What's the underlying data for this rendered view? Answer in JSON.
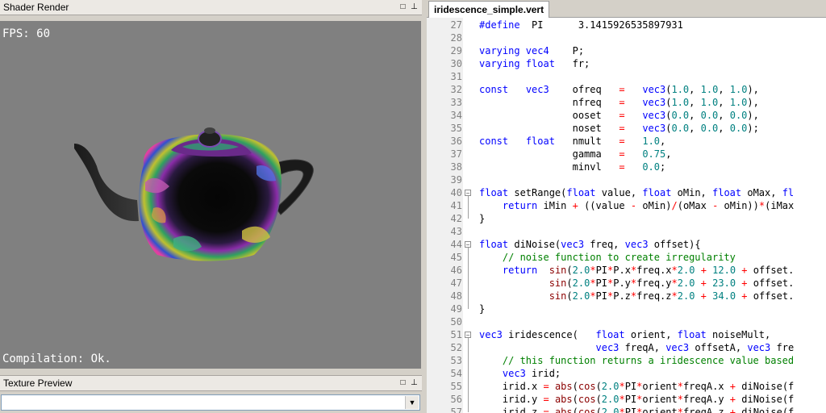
{
  "shader_render": {
    "title": "Shader Render",
    "fps_text": "FPS: 60",
    "status_text": "Compilation: Ok."
  },
  "texture_preview": {
    "title": "Texture Preview",
    "selected_value": ""
  },
  "editor": {
    "tab_label": "iridescence_simple.vert",
    "line_numbers": [
      "27",
      "28",
      "29",
      "30",
      "31",
      "32",
      "33",
      "34",
      "35",
      "36",
      "37",
      "38",
      "39",
      "40",
      "41",
      "42",
      "43",
      "44",
      "45",
      "46",
      "47",
      "48",
      "49",
      "50",
      "51",
      "52",
      "53",
      "54",
      "55",
      "56",
      "57"
    ],
    "lines": [
      [
        [
          "kw",
          "#define"
        ],
        [
          "",
          "  PI      3.1415926535897931"
        ]
      ],
      [],
      [
        [
          "kw",
          "varying vec4"
        ],
        [
          "",
          "    P;"
        ]
      ],
      [
        [
          "kw",
          "varying float"
        ],
        [
          "",
          "   fr;"
        ]
      ],
      [],
      [
        [
          "kw",
          "const"
        ],
        [
          "",
          "   "
        ],
        [
          "kw",
          "vec3"
        ],
        [
          "",
          "    ofreq   "
        ],
        [
          "op",
          "="
        ],
        [
          "",
          "   "
        ],
        [
          "kw",
          "vec3"
        ],
        [
          "",
          "("
        ],
        [
          "num",
          "1.0"
        ],
        [
          "",
          ", "
        ],
        [
          "num",
          "1.0"
        ],
        [
          "",
          ", "
        ],
        [
          "num",
          "1.0"
        ],
        [
          "",
          "),"
        ]
      ],
      [
        [
          "",
          "                nfreq   "
        ],
        [
          "op",
          "="
        ],
        [
          "",
          "   "
        ],
        [
          "kw",
          "vec3"
        ],
        [
          "",
          "("
        ],
        [
          "num",
          "1.0"
        ],
        [
          "",
          ", "
        ],
        [
          "num",
          "1.0"
        ],
        [
          "",
          ", "
        ],
        [
          "num",
          "1.0"
        ],
        [
          "",
          "),"
        ]
      ],
      [
        [
          "",
          "                ooset   "
        ],
        [
          "op",
          "="
        ],
        [
          "",
          "   "
        ],
        [
          "kw",
          "vec3"
        ],
        [
          "",
          "("
        ],
        [
          "num",
          "0.0"
        ],
        [
          "",
          ", "
        ],
        [
          "num",
          "0.0"
        ],
        [
          "",
          ", "
        ],
        [
          "num",
          "0.0"
        ],
        [
          "",
          "),"
        ]
      ],
      [
        [
          "",
          "                noset   "
        ],
        [
          "op",
          "="
        ],
        [
          "",
          "   "
        ],
        [
          "kw",
          "vec3"
        ],
        [
          "",
          "("
        ],
        [
          "num",
          "0.0"
        ],
        [
          "",
          ", "
        ],
        [
          "num",
          "0.0"
        ],
        [
          "",
          ", "
        ],
        [
          "num",
          "0.0"
        ],
        [
          "",
          ");"
        ]
      ],
      [
        [
          "kw",
          "const"
        ],
        [
          "",
          "   "
        ],
        [
          "kw",
          "float"
        ],
        [
          "",
          "   nmult   "
        ],
        [
          "op",
          "="
        ],
        [
          "",
          "   "
        ],
        [
          "num",
          "1.0"
        ],
        [
          "",
          ","
        ]
      ],
      [
        [
          "",
          "                gamma   "
        ],
        [
          "op",
          "="
        ],
        [
          "",
          "   "
        ],
        [
          "num",
          "0.75"
        ],
        [
          "",
          ","
        ]
      ],
      [
        [
          "",
          "                minvl   "
        ],
        [
          "op",
          "="
        ],
        [
          "",
          "   "
        ],
        [
          "num",
          "0.0"
        ],
        [
          "",
          ";"
        ]
      ],
      [],
      [
        [
          "kw",
          "float"
        ],
        [
          "",
          " setRange("
        ],
        [
          "kw",
          "float"
        ],
        [
          "",
          " value, "
        ],
        [
          "kw",
          "float"
        ],
        [
          "",
          " oMin, "
        ],
        [
          "kw",
          "float"
        ],
        [
          "",
          " oMax, "
        ],
        [
          "kw",
          "fl"
        ]
      ],
      [
        [
          "",
          "    "
        ],
        [
          "kw",
          "return"
        ],
        [
          "",
          " iMin "
        ],
        [
          "op",
          "+"
        ],
        [
          "",
          " ((value "
        ],
        [
          "op",
          "-"
        ],
        [
          "",
          " oMin)"
        ],
        [
          "op",
          "/"
        ],
        [
          "",
          "(oMax "
        ],
        [
          "op",
          "-"
        ],
        [
          "",
          " oMin))"
        ],
        [
          "op",
          "*"
        ],
        [
          "",
          "(iMax"
        ]
      ],
      [
        [
          "",
          "}"
        ]
      ],
      [],
      [
        [
          "kw",
          "float"
        ],
        [
          "",
          " diNoise("
        ],
        [
          "kw",
          "vec3"
        ],
        [
          "",
          " freq, "
        ],
        [
          "kw",
          "vec3"
        ],
        [
          "",
          " offset){"
        ]
      ],
      [
        [
          "cm",
          "    // noise function to create irregularity"
        ]
      ],
      [
        [
          "",
          "    "
        ],
        [
          "kw",
          "return"
        ],
        [
          "",
          "  "
        ],
        [
          "fn",
          "sin"
        ],
        [
          "",
          "("
        ],
        [
          "num",
          "2.0"
        ],
        [
          "op",
          "*"
        ],
        [
          "",
          "PI"
        ],
        [
          "op",
          "*"
        ],
        [
          "",
          "P.x"
        ],
        [
          "op",
          "*"
        ],
        [
          "",
          "freq.x"
        ],
        [
          "op",
          "*"
        ],
        [
          "num",
          "2.0"
        ],
        [
          "",
          " "
        ],
        [
          "op",
          "+"
        ],
        [
          "",
          " "
        ],
        [
          "num",
          "12.0"
        ],
        [
          "",
          " "
        ],
        [
          "op",
          "+"
        ],
        [
          "",
          " offset."
        ]
      ],
      [
        [
          "",
          "            "
        ],
        [
          "fn",
          "sin"
        ],
        [
          "",
          "("
        ],
        [
          "num",
          "2.0"
        ],
        [
          "op",
          "*"
        ],
        [
          "",
          "PI"
        ],
        [
          "op",
          "*"
        ],
        [
          "",
          "P.y"
        ],
        [
          "op",
          "*"
        ],
        [
          "",
          "freq.y"
        ],
        [
          "op",
          "*"
        ],
        [
          "num",
          "2.0"
        ],
        [
          "",
          " "
        ],
        [
          "op",
          "+"
        ],
        [
          "",
          " "
        ],
        [
          "num",
          "23.0"
        ],
        [
          "",
          " "
        ],
        [
          "op",
          "+"
        ],
        [
          "",
          " offset."
        ]
      ],
      [
        [
          "",
          "            "
        ],
        [
          "fn",
          "sin"
        ],
        [
          "",
          "("
        ],
        [
          "num",
          "2.0"
        ],
        [
          "op",
          "*"
        ],
        [
          "",
          "PI"
        ],
        [
          "op",
          "*"
        ],
        [
          "",
          "P.z"
        ],
        [
          "op",
          "*"
        ],
        [
          "",
          "freq.z"
        ],
        [
          "op",
          "*"
        ],
        [
          "num",
          "2.0"
        ],
        [
          "",
          " "
        ],
        [
          "op",
          "+"
        ],
        [
          "",
          " "
        ],
        [
          "num",
          "34.0"
        ],
        [
          "",
          " "
        ],
        [
          "op",
          "+"
        ],
        [
          "",
          " offset."
        ]
      ],
      [
        [
          "",
          "}"
        ]
      ],
      [],
      [
        [
          "kw",
          "vec3"
        ],
        [
          "",
          " iridescence(   "
        ],
        [
          "kw",
          "float"
        ],
        [
          "",
          " orient, "
        ],
        [
          "kw",
          "float"
        ],
        [
          "",
          " noiseMult,"
        ]
      ],
      [
        [
          "",
          "                    "
        ],
        [
          "kw",
          "vec3"
        ],
        [
          "",
          " freqA, "
        ],
        [
          "kw",
          "vec3"
        ],
        [
          "",
          " offsetA, "
        ],
        [
          "kw",
          "vec3"
        ],
        [
          "",
          " fre"
        ]
      ],
      [
        [
          "cm",
          "    // this function returns a iridescence value based"
        ]
      ],
      [
        [
          "",
          "    "
        ],
        [
          "kw",
          "vec3"
        ],
        [
          "",
          " irid;"
        ]
      ],
      [
        [
          "",
          "    irid.x "
        ],
        [
          "op",
          "="
        ],
        [
          "",
          " "
        ],
        [
          "fn",
          "abs"
        ],
        [
          "",
          "("
        ],
        [
          "fn",
          "cos"
        ],
        [
          "",
          "("
        ],
        [
          "num",
          "2.0"
        ],
        [
          "op",
          "*"
        ],
        [
          "",
          "PI"
        ],
        [
          "op",
          "*"
        ],
        [
          "",
          "orient"
        ],
        [
          "op",
          "*"
        ],
        [
          "",
          "freqA.x "
        ],
        [
          "op",
          "+"
        ],
        [
          "",
          " diNoise(f"
        ]
      ],
      [
        [
          "",
          "    irid.y "
        ],
        [
          "op",
          "="
        ],
        [
          "",
          " "
        ],
        [
          "fn",
          "abs"
        ],
        [
          "",
          "("
        ],
        [
          "fn",
          "cos"
        ],
        [
          "",
          "("
        ],
        [
          "num",
          "2.0"
        ],
        [
          "op",
          "*"
        ],
        [
          "",
          "PI"
        ],
        [
          "op",
          "*"
        ],
        [
          "",
          "orient"
        ],
        [
          "op",
          "*"
        ],
        [
          "",
          "freqA.y "
        ],
        [
          "op",
          "+"
        ],
        [
          "",
          " diNoise(f"
        ]
      ],
      [
        [
          "",
          "    irid.z "
        ],
        [
          "op",
          "="
        ],
        [
          "",
          " "
        ],
        [
          "fn",
          "abs"
        ],
        [
          "",
          "("
        ],
        [
          "fn",
          "cos"
        ],
        [
          "",
          "("
        ],
        [
          "num",
          "2.0"
        ],
        [
          "op",
          "*"
        ],
        [
          "",
          "PI"
        ],
        [
          "op",
          "*"
        ],
        [
          "",
          "orient"
        ],
        [
          "op",
          "*"
        ],
        [
          "",
          "freqA.z "
        ],
        [
          "op",
          "+"
        ],
        [
          "",
          " diNoise(f"
        ]
      ]
    ]
  }
}
